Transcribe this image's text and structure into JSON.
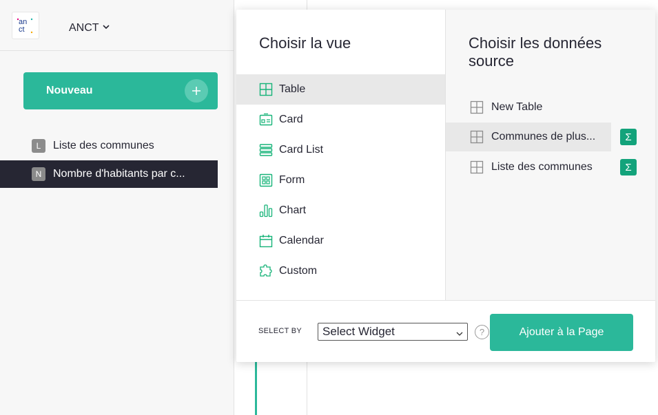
{
  "header": {
    "logo_text": "an ct",
    "org_name": "ANCT"
  },
  "sidebar": {
    "new_button_label": "Nouveau",
    "pages": [
      {
        "letter": "L",
        "label": "Liste des communes",
        "active": false
      },
      {
        "letter": "N",
        "label": "Nombre d'habitants par c...",
        "active": true
      }
    ]
  },
  "popup": {
    "view_title": "Choisir la vue",
    "source_title_line1": "Choisir les données",
    "source_title_line2": "source",
    "views": [
      {
        "label": "Table",
        "icon": "table-icon",
        "selected": true
      },
      {
        "label": "Card",
        "icon": "card-icon",
        "selected": false
      },
      {
        "label": "Card List",
        "icon": "card-list-icon",
        "selected": false
      },
      {
        "label": "Form",
        "icon": "form-icon",
        "selected": false
      },
      {
        "label": "Chart",
        "icon": "chart-icon",
        "selected": false
      },
      {
        "label": "Calendar",
        "icon": "calendar-icon",
        "selected": false
      },
      {
        "label": "Custom",
        "icon": "custom-icon",
        "selected": false
      }
    ],
    "sources": [
      {
        "label": "New Table",
        "icon": "table-icon",
        "summary": false
      },
      {
        "label": "Communes de plus...",
        "icon": "table-icon",
        "summary": true
      },
      {
        "label": "Liste des communes",
        "icon": "table-icon",
        "summary": true
      }
    ],
    "sigma_symbol": "Σ",
    "footer": {
      "select_by_label": "SELECT BY",
      "select_value": "Select Widget",
      "help_symbol": "?",
      "add_button_label": "Ajouter à la Page"
    }
  },
  "colors": {
    "accent": "#2bb89a",
    "sigma": "#13a37b",
    "active_page_bg": "#262633",
    "selected_row_bg": "#e8e8e8"
  }
}
